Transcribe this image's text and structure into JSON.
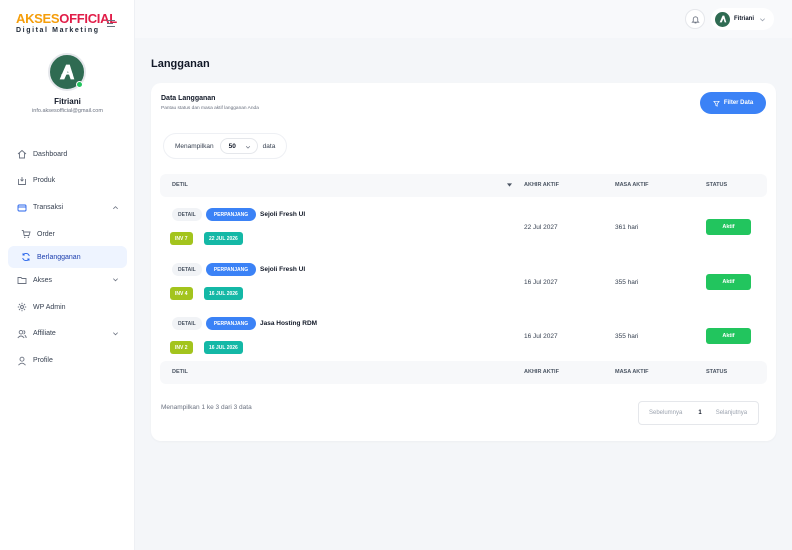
{
  "brand": {
    "logo_part1": "AKSES",
    "logo_part2": "OFFICIAL",
    "tagline": "Digital Marketing"
  },
  "user": {
    "name": "Fitriani",
    "email": "info.aksesofficial@gmail.com"
  },
  "sidebar": {
    "items": [
      {
        "label": "Dashboard"
      },
      {
        "label": "Produk"
      },
      {
        "label": "Transaksi"
      },
      {
        "label": "Order"
      },
      {
        "label": "Berlangganan"
      },
      {
        "label": "Akses"
      },
      {
        "label": "WP Admin"
      },
      {
        "label": "Affiliate"
      },
      {
        "label": "Profile"
      }
    ]
  },
  "header": {
    "user_name": "Fitriani"
  },
  "page": {
    "title": "Langganan"
  },
  "card": {
    "title": "Data Langganan",
    "subtitle": "Pantau status dan masa aktif langganan Anda",
    "filter_label": "Filter Data",
    "show_label": "Menampilkan",
    "show_value": "50",
    "show_suffix": "data"
  },
  "table": {
    "headers": {
      "detail": "DETIL",
      "end": "AKHIR AKTIF",
      "period": "MASA AKTIF",
      "status": "STATUS"
    },
    "rows": [
      {
        "detail": "DETAIL",
        "type": "PERPANJANG",
        "product": "Sejoli Fresh UI",
        "invoice": "INV 7",
        "date": "22 JUL 2026",
        "end": "22 Jul 2027",
        "period": "361 hari",
        "status": "Aktif"
      },
      {
        "detail": "DETAIL",
        "type": "PERPANJANG",
        "product": "Sejoli Fresh UI",
        "invoice": "INV 4",
        "date": "16 JUL 2026",
        "end": "16 Jul 2027",
        "period": "355 hari",
        "status": "Aktif"
      },
      {
        "detail": "DETAIL",
        "type": "PERPANJANG",
        "product": "Jasa Hosting RDM",
        "invoice": "INV 2",
        "date": "16 JUL 2026",
        "end": "16 Jul 2027",
        "period": "355 hari",
        "status": "Aktif"
      }
    ]
  },
  "pagination": {
    "info": "Menampilkan 1 ke 3 dari 3 data",
    "prev": "Sebelumnya",
    "page": "1",
    "next": "Selanjutnya"
  },
  "colors": {
    "primary": "#3b82f6",
    "success": "#22c55e",
    "invoice": "#a3c41d",
    "date": "#14b8a6",
    "avatar": "#2f6b52"
  }
}
